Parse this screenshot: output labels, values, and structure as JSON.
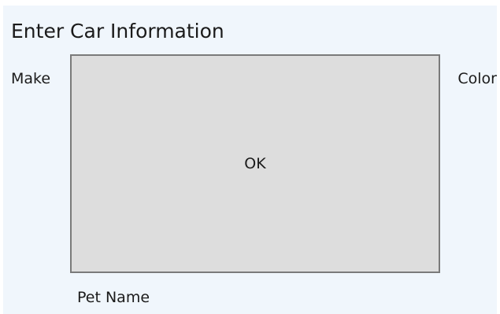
{
  "form": {
    "title": "Enter Car Information",
    "make_label": "Make",
    "color_label": "Color",
    "pet_name_label": "Pet Name",
    "ok_button_label": "OK"
  },
  "colors": {
    "window_background": "#f0f6fc",
    "button_background": "#dddddd",
    "button_border": "#7a7a7a",
    "text": "#1b1b1b"
  }
}
